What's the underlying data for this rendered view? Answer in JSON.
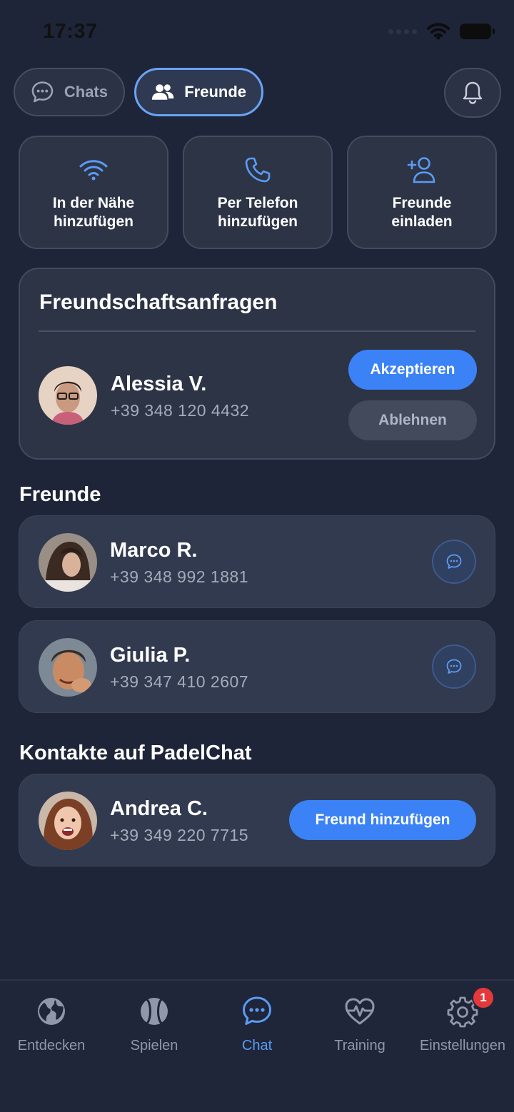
{
  "status_bar": {
    "time": "17:37"
  },
  "top_tabs": [
    {
      "label": "Chats",
      "icon": "chat-bubble-icon",
      "active": false
    },
    {
      "label": "Freunde",
      "icon": "people-icon",
      "active": true
    }
  ],
  "quick_actions": [
    {
      "label": "In der Nähe\nhinzufügen",
      "icon": "wifi-icon"
    },
    {
      "label": "Per Telefon\nhinzufügen",
      "icon": "phone-icon"
    },
    {
      "label": "Freunde\neinladen",
      "icon": "add-user-icon"
    }
  ],
  "requests": {
    "title": "Freundschaftsanfragen",
    "items": [
      {
        "name": "Alessia V.",
        "phone": "+39 348 120 4432",
        "accept_label": "Akzeptieren",
        "decline_label": "Ablehnen"
      }
    ]
  },
  "friends": {
    "heading": "Freunde",
    "items": [
      {
        "name": "Marco R.",
        "phone": "+39 348 992 1881"
      },
      {
        "name": "Giulia P.",
        "phone": "+39 347 410 2607"
      }
    ]
  },
  "contacts": {
    "heading": "Kontakte auf PadelChat",
    "items": [
      {
        "name": "Andrea C.",
        "phone": "+39 349 220 7715",
        "add_label": "Freund hinzufügen"
      }
    ]
  },
  "bottom_nav": [
    {
      "label": "Entdecken",
      "icon": "globe-icon",
      "active": false
    },
    {
      "label": "Spielen",
      "icon": "tennis-ball-icon",
      "active": false
    },
    {
      "label": "Chat",
      "icon": "chat-icon",
      "active": true
    },
    {
      "label": "Training",
      "icon": "heart-pulse-icon",
      "active": false
    },
    {
      "label": "Einstellungen",
      "icon": "gear-icon",
      "active": false,
      "badge": "1"
    }
  ],
  "colors": {
    "accent": "#3b82f6",
    "background": "#1e2538",
    "card": "#2d3446",
    "badge": "#e5383b"
  }
}
